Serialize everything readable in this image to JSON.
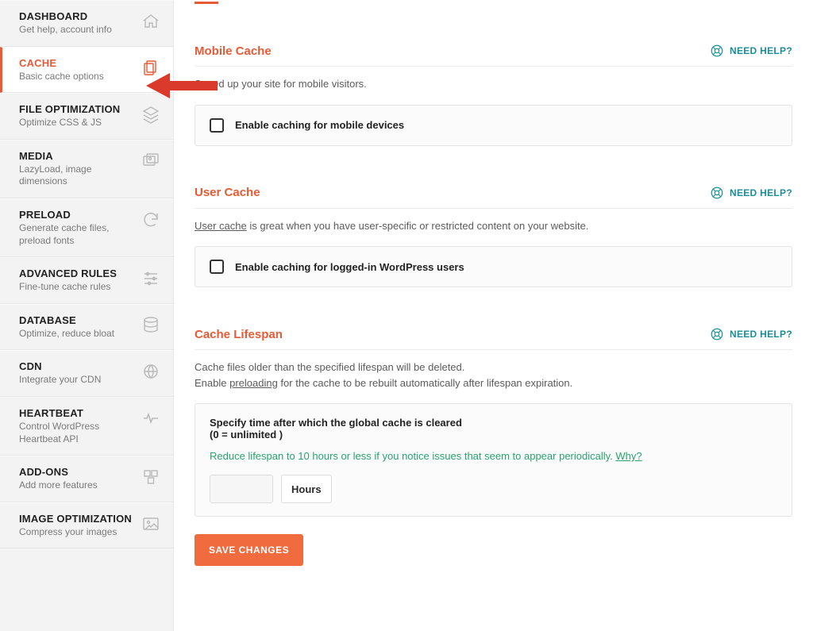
{
  "sidebar": {
    "items": [
      {
        "title": "DASHBOARD",
        "subtitle": "Get help, account info",
        "icon": "home"
      },
      {
        "title": "CACHE",
        "subtitle": "Basic cache options",
        "icon": "files",
        "active": true
      },
      {
        "title": "FILE OPTIMIZATION",
        "subtitle": "Optimize CSS & JS",
        "icon": "layers"
      },
      {
        "title": "MEDIA",
        "subtitle": "LazyLoad, image dimensions",
        "icon": "gallery"
      },
      {
        "title": "PRELOAD",
        "subtitle": "Generate cache files, preload fonts",
        "icon": "refresh"
      },
      {
        "title": "ADVANCED RULES",
        "subtitle": "Fine-tune cache rules",
        "icon": "sliders"
      },
      {
        "title": "DATABASE",
        "subtitle": "Optimize, reduce bloat",
        "icon": "database"
      },
      {
        "title": "CDN",
        "subtitle": "Integrate your CDN",
        "icon": "globe"
      },
      {
        "title": "HEARTBEAT",
        "subtitle": "Control WordPress Heartbeat API",
        "icon": "heartbeat"
      },
      {
        "title": "ADD-ONS",
        "subtitle": "Add more features",
        "icon": "cubes"
      },
      {
        "title": "IMAGE OPTIMIZATION",
        "subtitle": "Compress your images",
        "icon": "image"
      }
    ]
  },
  "help_label": "NEED HELP?",
  "mobile": {
    "title": "Mobile Cache",
    "desc": "Speed up your site for mobile visitors.",
    "checkbox_label": "Enable caching for mobile devices"
  },
  "user": {
    "title": "User Cache",
    "desc_prefix": "User cache",
    "desc_rest": " is great when you have user-specific or restricted content on your website.",
    "checkbox_label": "Enable caching for logged-in WordPress users"
  },
  "lifespan": {
    "title": "Cache Lifespan",
    "desc_line1": "Cache files older than the specified lifespan will be deleted.",
    "desc_line2_prefix": "Enable ",
    "desc_line2_link": "preloading",
    "desc_line2_rest": " for the cache to be rebuilt automatically after lifespan expiration.",
    "box_title": "Specify time after which the global cache is cleared",
    "box_sub": "(0 = unlimited )",
    "hint_text": "Reduce lifespan to 10 hours or less if you notice issues that seem to appear periodically. ",
    "hint_link": "Why?",
    "value": "",
    "unit": "Hours"
  },
  "save_label": "SAVE CHANGES"
}
